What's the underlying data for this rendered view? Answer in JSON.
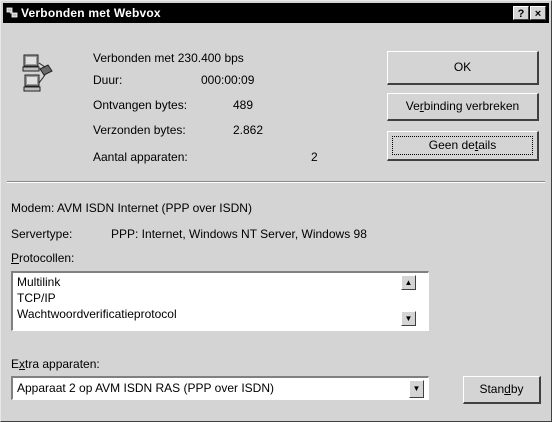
{
  "window": {
    "title": "Verbonden met Webvox"
  },
  "titlebar": {
    "help_label": "?",
    "close_label": "×"
  },
  "icon": "network-computers-icon",
  "stats": {
    "connected_label": "Verbonden met 230.400 bps",
    "duration_label": "Duur:",
    "duration_value": "000:00:09",
    "received_label": "Ontvangen bytes:",
    "received_value": "489",
    "sent_label": "Verzonden bytes:",
    "sent_value": "2.862",
    "devices_label": "Aantal apparaten:",
    "devices_value": "2"
  },
  "buttons": {
    "ok": "OK",
    "disconnect_pre": "Ve",
    "disconnect_u": "r",
    "disconnect_post": "binding verbreken",
    "details_pre": "Geen de",
    "details_u": "t",
    "details_post": "ails",
    "standby_pre": "Stan",
    "standby_u": "d",
    "standby_post": "by"
  },
  "info": {
    "modem": "Modem: AVM ISDN Internet (PPP over ISDN)",
    "servertype_label": "Servertype:",
    "servertype_value": "PPP: Internet, Windows NT Server, Windows 98",
    "protocols_label_u": "P",
    "protocols_label_rest": "rotocollen:"
  },
  "protocols": [
    "Multilink",
    "TCP/IP",
    "Wachtwoordverificatieprotocol"
  ],
  "extra": {
    "label_pre": "E",
    "label_u": "x",
    "label_post": "tra apparaten:",
    "selected": "Apparaat 2 op AVM ISDN RAS (PPP over ISDN)"
  }
}
